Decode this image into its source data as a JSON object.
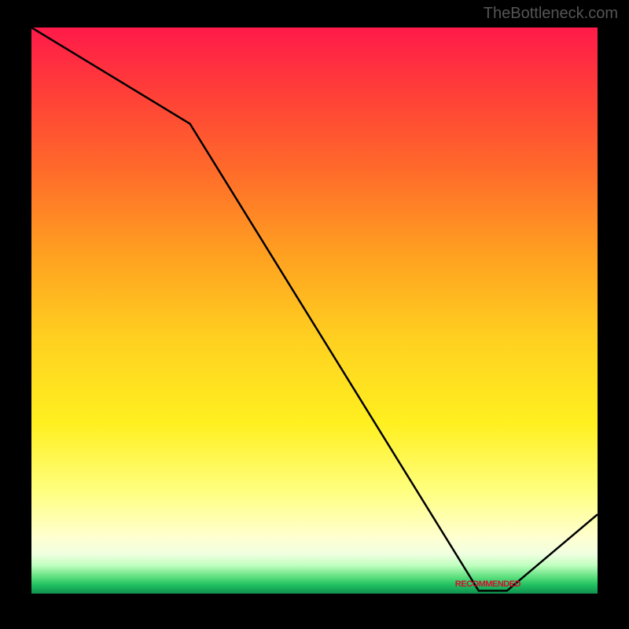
{
  "watermark": "TheBottleneck.com",
  "bottom_label": "RECOMMENDED",
  "chart_data": {
    "type": "line",
    "title": "",
    "xlabel": "",
    "ylabel": "",
    "xlim": [
      0,
      100
    ],
    "ylim": [
      0,
      100
    ],
    "series": [
      {
        "name": "curve",
        "x": [
          0,
          28,
          79,
          84,
          100
        ],
        "y": [
          100,
          83,
          0.5,
          0.5,
          14
        ]
      }
    ],
    "gradient_stops": [
      {
        "pos": 0,
        "color": "#ff1a4a"
      },
      {
        "pos": 10,
        "color": "#ff3a3a"
      },
      {
        "pos": 25,
        "color": "#ff6a2a"
      },
      {
        "pos": 40,
        "color": "#ffa020"
      },
      {
        "pos": 55,
        "color": "#ffd020"
      },
      {
        "pos": 70,
        "color": "#fff020"
      },
      {
        "pos": 82,
        "color": "#ffff80"
      },
      {
        "pos": 90,
        "color": "#ffffd0"
      },
      {
        "pos": 93,
        "color": "#f0ffe0"
      },
      {
        "pos": 95,
        "color": "#c0ffc0"
      },
      {
        "pos": 97,
        "color": "#60e080"
      },
      {
        "pos": 98.5,
        "color": "#20c060"
      },
      {
        "pos": 100,
        "color": "#109050"
      }
    ],
    "label_position_x_pct": 79
  }
}
